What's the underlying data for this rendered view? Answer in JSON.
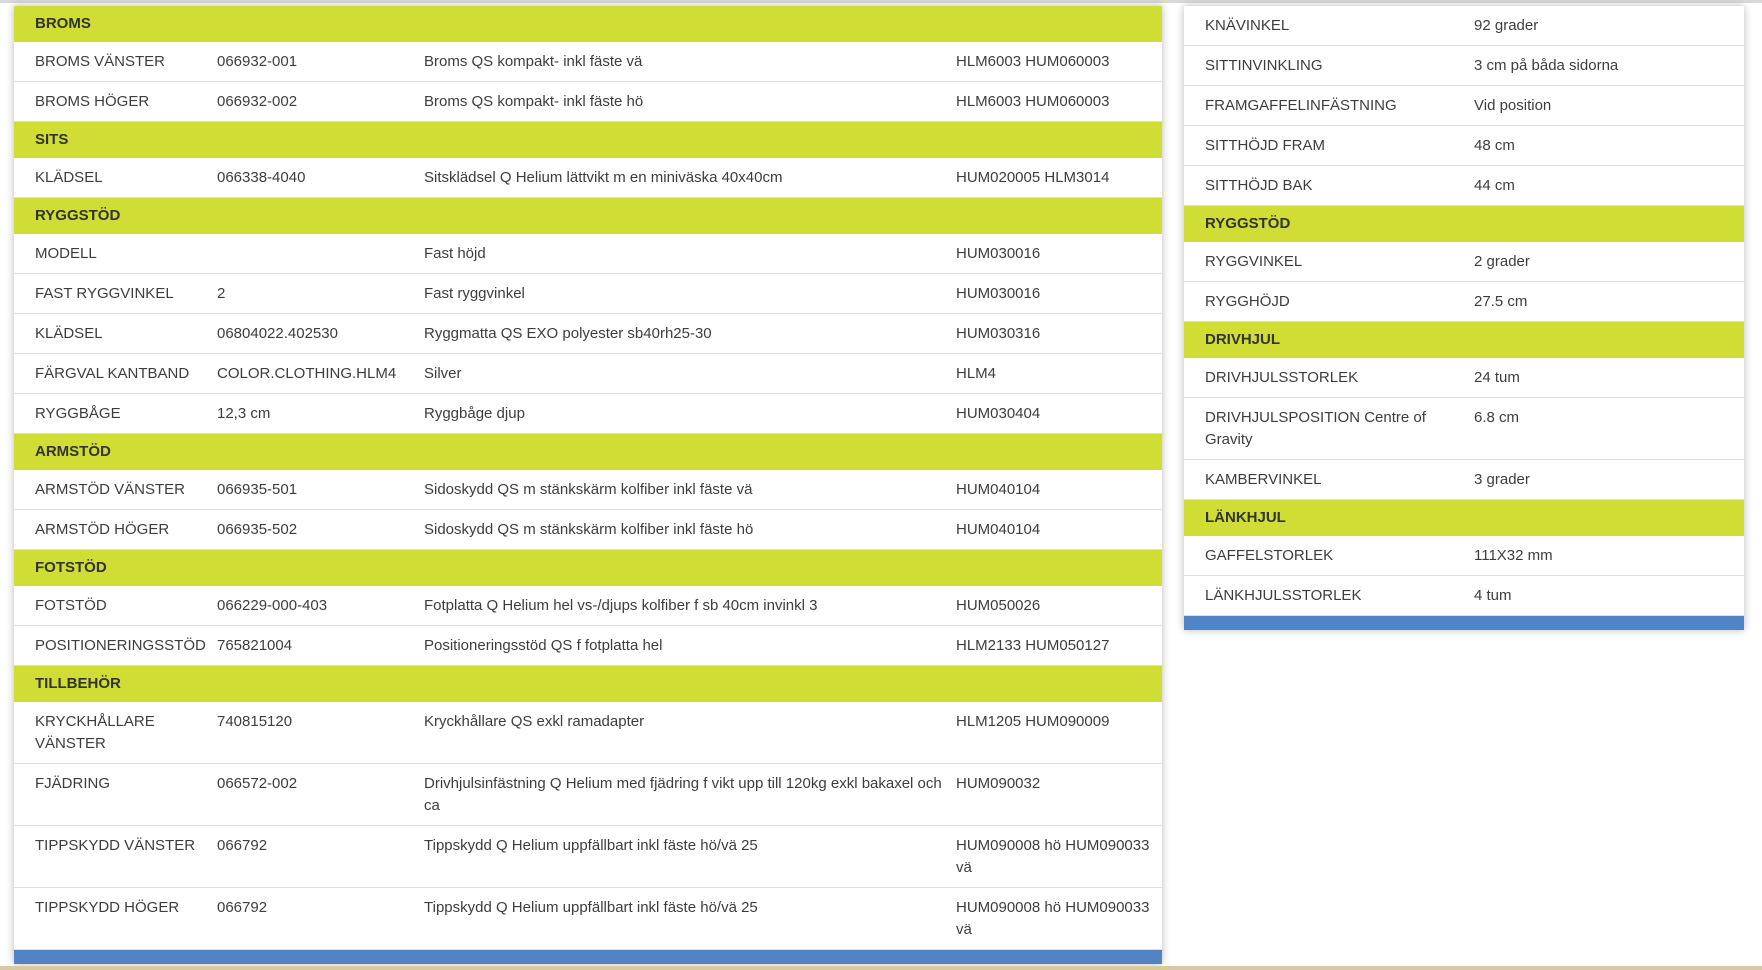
{
  "left": {
    "sections": [
      {
        "title": "BROMS",
        "rows": [
          {
            "name": "BROMS VÄNSTER",
            "code": "066932-001",
            "desc": "Broms QS kompakt- inkl fäste vä",
            "ref": "HLM6003 HUM060003"
          },
          {
            "name": "BROMS HÖGER",
            "code": "066932-002",
            "desc": "Broms QS kompakt- inkl fäste hö",
            "ref": "HLM6003 HUM060003"
          }
        ]
      },
      {
        "title": "SITS",
        "rows": [
          {
            "name": "KLÄDSEL",
            "code": "066338-4040",
            "desc": "Sitsklädsel Q Helium lättvikt m en miniväska 40x40cm",
            "ref": "HUM020005 HLM3014"
          }
        ]
      },
      {
        "title": "RYGGSTÖD",
        "rows": [
          {
            "name": "MODELL",
            "code": "",
            "desc": "Fast höjd",
            "ref": "HUM030016"
          },
          {
            "name": "FAST RYGGVINKEL",
            "code": "2",
            "desc": "Fast ryggvinkel",
            "ref": "HUM030016"
          },
          {
            "name": "KLÄDSEL",
            "code": "06804022.402530",
            "desc": "Ryggmatta QS EXO polyester sb40rh25-30",
            "ref": "HUM030316"
          },
          {
            "name": "FÄRGVAL KANTBAND",
            "code": "COLOR.CLOTHING.HLM4",
            "desc": "Silver",
            "ref": "HLM4"
          },
          {
            "name": "RYGGBÅGE",
            "code": "12,3 cm",
            "desc": "Ryggbåge djup",
            "ref": "HUM030404"
          }
        ]
      },
      {
        "title": "ARMSTÖD",
        "rows": [
          {
            "name": "ARMSTÖD VÄNSTER",
            "code": "066935-501",
            "desc": "Sidoskydd QS m stänkskärm kolfiber inkl fäste vä",
            "ref": "HUM040104"
          },
          {
            "name": "ARMSTÖD HÖGER",
            "code": "066935-502",
            "desc": "Sidoskydd QS m stänkskärm kolfiber inkl fäste hö",
            "ref": "HUM040104"
          }
        ]
      },
      {
        "title": "FOTSTÖD",
        "rows": [
          {
            "name": "FOTSTÖD",
            "code": "066229-000-403",
            "desc": "Fotplatta Q Helium hel vs-/djups kolfiber f sb 40cm invinkl 3",
            "ref": "HUM050026"
          },
          {
            "name": "POSITIONERINGSSTÖD",
            "code": "765821004",
            "desc": "Positioneringsstöd QS f fotplatta hel",
            "ref": "HLM2133 HUM050127"
          }
        ]
      },
      {
        "title": "TILLBEHÖR",
        "rows": [
          {
            "name": "KRYCKHÅLLARE VÄNSTER",
            "code": "740815120",
            "desc": "Kryckhållare QS exkl ramadapter",
            "ref": "HLM1205 HUM090009"
          },
          {
            "name": "FJÄDRING",
            "code": "066572-002",
            "desc": "Drivhjulsinfästning Q Helium med fjädring f vikt upp till 120kg exkl bakaxel och ca",
            "ref": "HUM090032"
          },
          {
            "name": "TIPPSKYDD VÄNSTER",
            "code": "066792",
            "desc": "Tippskydd Q Helium uppfällbart inkl fäste hö/vä 25",
            "ref": "HUM090008 hö HUM090033 vä"
          },
          {
            "name": "TIPPSKYDD HÖGER",
            "code": "066792",
            "desc": "Tippskydd Q Helium uppfällbart inkl fäste hö/vä 25",
            "ref": "HUM090008 hö HUM090033 vä"
          }
        ]
      }
    ]
  },
  "right": {
    "top_rows": [
      {
        "name": "KNÄVINKEL",
        "value": "92 grader"
      },
      {
        "name": "SITTINVINKLING",
        "value": "3 cm på båda sidorna"
      },
      {
        "name": "FRAMGAFFELINFÄSTNING",
        "value": "Vid position"
      },
      {
        "name": "SITTHÖJD FRAM",
        "value": "48 cm"
      },
      {
        "name": "SITTHÖJD BAK",
        "value": "44 cm"
      }
    ],
    "sections": [
      {
        "title": "RYGGSTÖD",
        "rows": [
          {
            "name": "RYGGVINKEL",
            "value": "2 grader"
          },
          {
            "name": "RYGGHÖJD",
            "value": "27.5 cm"
          }
        ]
      },
      {
        "title": "DRIVHJUL",
        "rows": [
          {
            "name": "DRIVHJULSSTORLEK",
            "value": "24 tum"
          },
          {
            "name": "DRIVHJULSPOSITION",
            "name_extra": "Centre of Gravity",
            "value": "6.8 cm"
          },
          {
            "name": "KAMBERVINKEL",
            "value": "3 grader"
          }
        ]
      },
      {
        "title": "LÄNKHJUL",
        "rows": [
          {
            "name": "GAFFELSTORLEK",
            "value": "111X32 mm"
          },
          {
            "name": "LÄNKHJULSSTORLEK",
            "value": "4 tum"
          }
        ]
      }
    ]
  },
  "colors": {
    "section_bg": "#cfdd35",
    "footer_bar": "#5283c4",
    "divider": "#dedede"
  }
}
